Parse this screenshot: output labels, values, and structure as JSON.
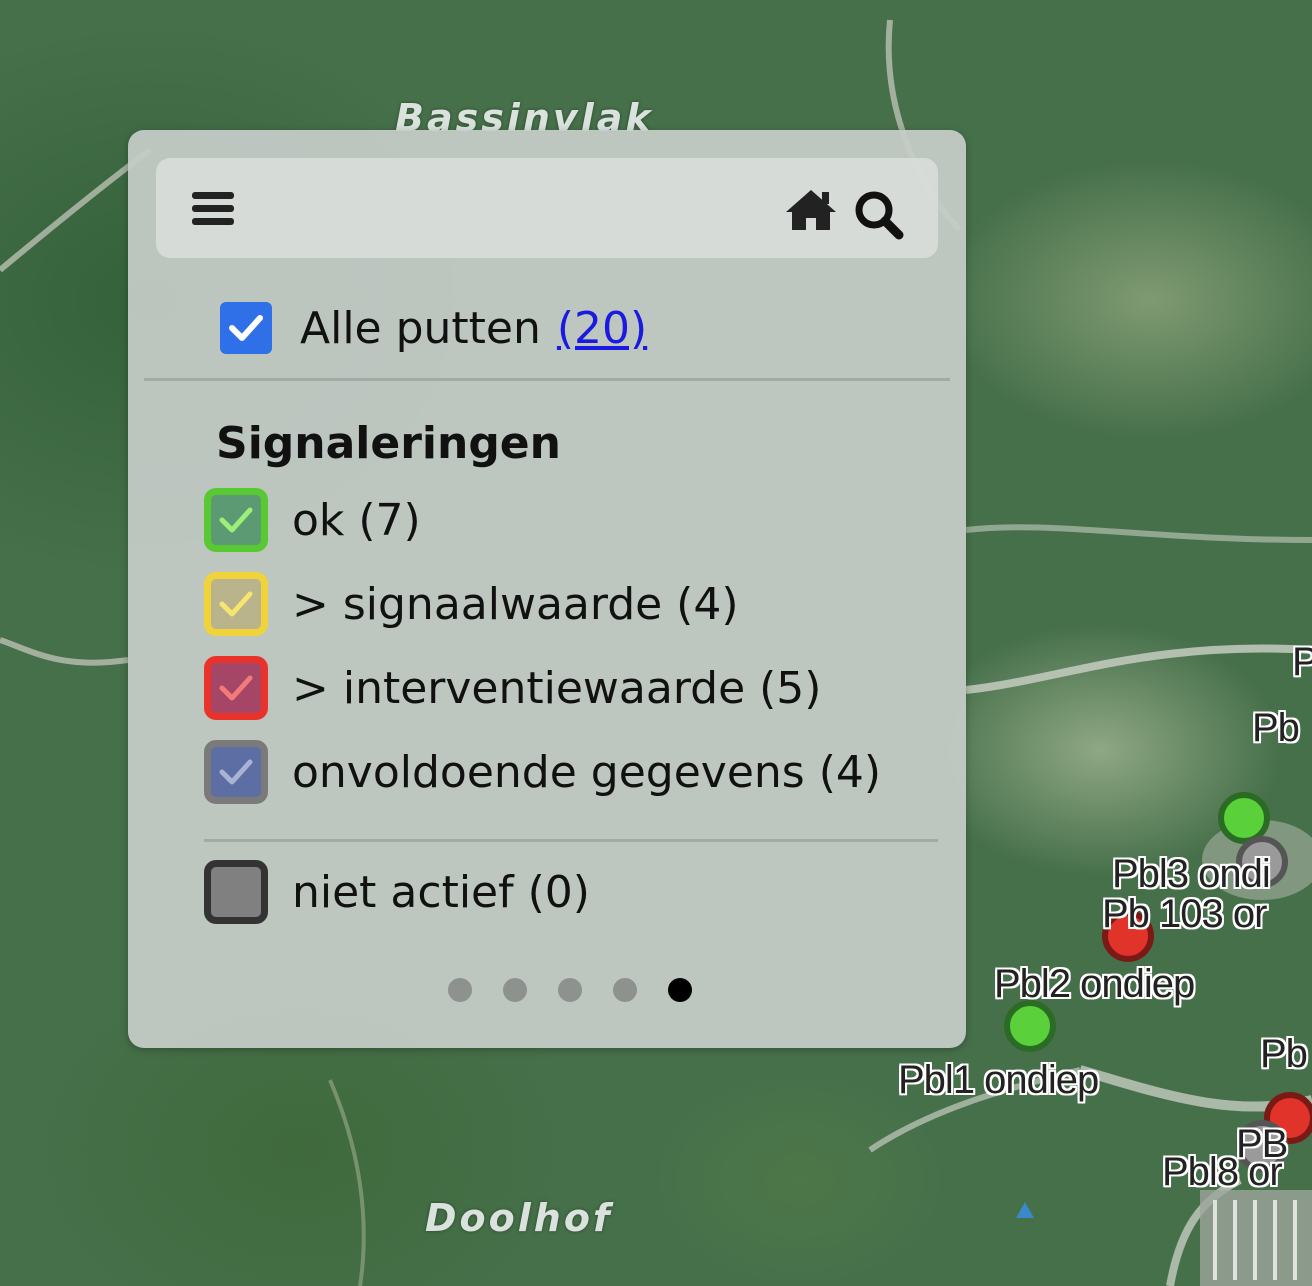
{
  "map": {
    "place_labels": [
      "Bassinvlak",
      "Doolhof"
    ],
    "wells": [
      {
        "label": "Pbl3 ondi",
        "status": "ok"
      },
      {
        "label": "Pb 103 or",
        "status": "interventie"
      },
      {
        "label": "Pbl2 ondiep",
        "status": "interventie"
      },
      {
        "label": "Pbl1 ondiep",
        "status": "ok"
      },
      {
        "label": "PB",
        "status": "interventie"
      },
      {
        "label": "Pbl8 or",
        "status": "interventie"
      },
      {
        "label": "Pb",
        "status": "onvoldoende"
      },
      {
        "label": "Pb",
        "status": "onvoldoende"
      },
      {
        "label": "P",
        "status": "onvoldoende"
      }
    ]
  },
  "toolbar": {
    "menu_icon": "hamburger-menu-icon",
    "home_icon": "home-icon",
    "search_icon": "search-icon"
  },
  "filter": {
    "all_label": "Alle putten",
    "all_count": "(20)",
    "all_checked": true
  },
  "signaleringen": {
    "heading": "Signaleringen",
    "categories": [
      {
        "label": "ok (7)",
        "color": "#5ac832",
        "checked": true
      },
      {
        "label": "> signaalwaarde (4)",
        "color": "#f0d23a",
        "checked": true
      },
      {
        "label": "> interventiewaarde (5)",
        "color": "#e8322a",
        "checked": true
      },
      {
        "label": "onvoldoende gegevens (4)",
        "color": "#7a7a7a",
        "checked": true
      },
      {
        "label": "niet actief (0)",
        "color": "#333333",
        "checked": false
      }
    ]
  },
  "pagination": {
    "pages": 5,
    "active": 5
  }
}
